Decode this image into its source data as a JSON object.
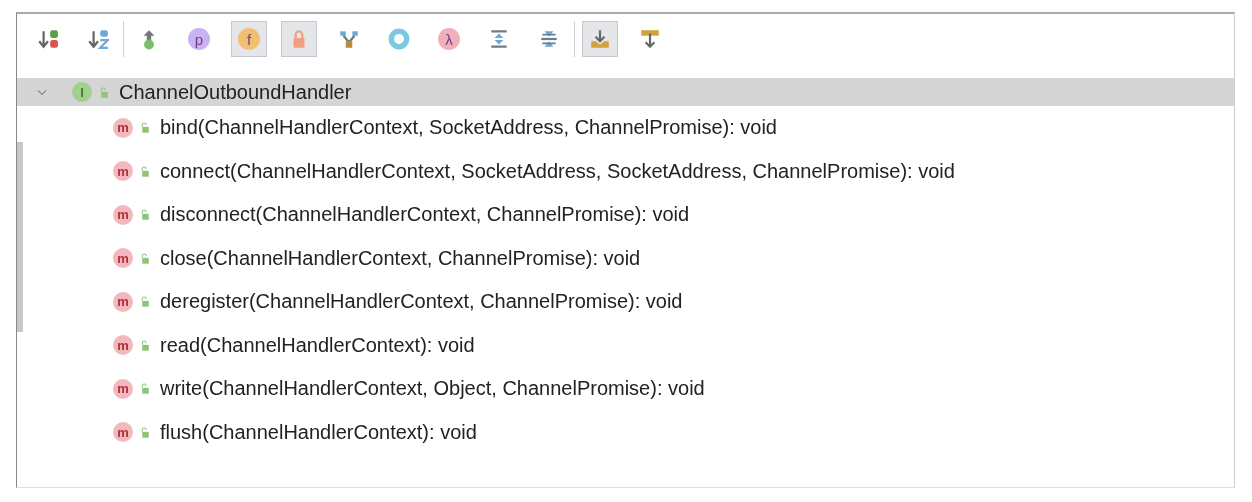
{
  "toolbar": [
    {
      "kind": "sort-visibility",
      "on": false
    },
    {
      "kind": "sort-alpha",
      "on": false
    },
    {
      "kind": "separator"
    },
    {
      "kind": "inherited",
      "on": false
    },
    {
      "kind": "badge",
      "glyph": "p",
      "color": "#c9b3f0",
      "on": false
    },
    {
      "kind": "badge",
      "glyph": "f",
      "color": "#f0c070",
      "on": true
    },
    {
      "kind": "lock",
      "on": true
    },
    {
      "kind": "anonymous",
      "on": false
    },
    {
      "kind": "ring",
      "on": false
    },
    {
      "kind": "badge",
      "glyph": "λ",
      "color": "#f0b0b8",
      "on": false
    },
    {
      "kind": "expand",
      "on": false
    },
    {
      "kind": "collapse",
      "on": false
    },
    {
      "kind": "separator"
    },
    {
      "kind": "autoscroll-to",
      "on": true
    },
    {
      "kind": "autoscroll-from",
      "on": false
    }
  ],
  "tree": {
    "label": "ChannelOutboundHandler",
    "glyph": "I",
    "expanded": true,
    "selected": true,
    "children": [
      {
        "glyph": "m",
        "label": "bind(ChannelHandlerContext, SocketAddress, ChannelPromise): void",
        "selected": false
      },
      {
        "glyph": "m",
        "label": "connect(ChannelHandlerContext, SocketAddress, SocketAddress, ChannelPromise): void",
        "selected": false
      },
      {
        "glyph": "m",
        "label": "disconnect(ChannelHandlerContext, ChannelPromise): void",
        "selected": false
      },
      {
        "glyph": "m",
        "label": "close(ChannelHandlerContext, ChannelPromise): void",
        "selected": false
      },
      {
        "glyph": "m",
        "label": "deregister(ChannelHandlerContext, ChannelPromise): void",
        "selected": false
      },
      {
        "glyph": "m",
        "label": "read(ChannelHandlerContext): void",
        "selected": false
      },
      {
        "glyph": "m",
        "label": "write(ChannelHandlerContext, Object, ChannelPromise): void",
        "selected": false
      },
      {
        "glyph": "m",
        "label": "flush(ChannelHandlerContext): void",
        "selected": false
      }
    ]
  }
}
